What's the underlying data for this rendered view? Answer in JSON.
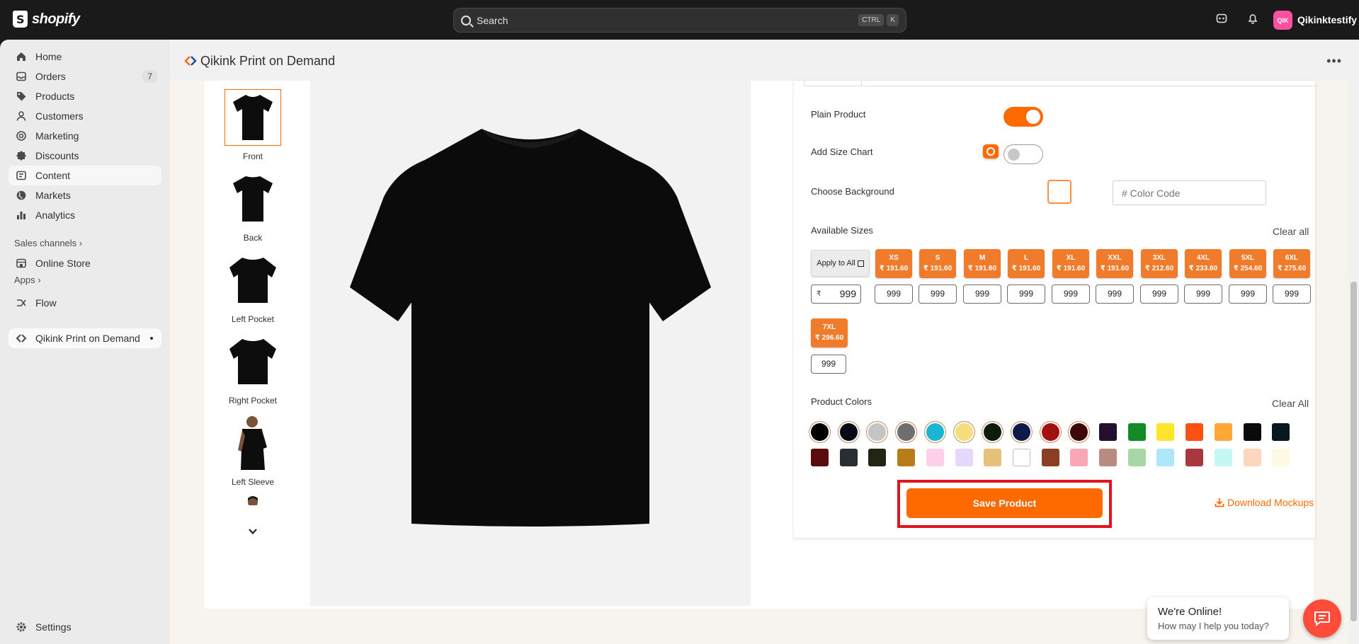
{
  "topbar": {
    "brand": "shopify",
    "search_placeholder": "Search",
    "shortcut_keys": [
      "CTRL",
      "K"
    ],
    "store_initials": "QIK",
    "store_name": "Qikinktestify"
  },
  "sidebar": {
    "items": [
      {
        "label": "Home",
        "icon": "home-icon"
      },
      {
        "label": "Orders",
        "icon": "orders-icon",
        "badge": "7"
      },
      {
        "label": "Products",
        "icon": "tag-icon"
      },
      {
        "label": "Customers",
        "icon": "person-icon"
      },
      {
        "label": "Marketing",
        "icon": "target-icon"
      },
      {
        "label": "Discounts",
        "icon": "discount-icon"
      },
      {
        "label": "Content",
        "icon": "content-icon"
      },
      {
        "label": "Markets",
        "icon": "globe-icon"
      },
      {
        "label": "Analytics",
        "icon": "chart-bar-icon"
      }
    ],
    "sales_channels_title": "Sales channels",
    "online_store": "Online Store",
    "apps_title": "Apps",
    "flow": "Flow",
    "current_app": "Qikink Print on Demand",
    "settings": "Settings"
  },
  "app": {
    "title": "Qikink Print on Demand",
    "thumbnails": [
      "Front",
      "Back",
      "Left Pocket",
      "Right Pocket",
      "Left Sleeve"
    ],
    "plain_product_label": "Plain Product",
    "plain_product_on": true,
    "add_size_chart_label": "Add Size Chart",
    "add_size_chart_on": false,
    "choose_background_label": "Choose Background",
    "color_code_placeholder": "# Color Code",
    "available_sizes_label": "Available Sizes",
    "clear_all_sizes": "Clear all",
    "apply_to_all": "Apply to All",
    "apply_price": "999",
    "currency_symbol": "₹",
    "sizes": [
      {
        "size": "XS",
        "cost": "₹ 191.60",
        "price": "999"
      },
      {
        "size": "S",
        "cost": "₹ 191.60",
        "price": "999"
      },
      {
        "size": "M",
        "cost": "₹ 191.60",
        "price": "999"
      },
      {
        "size": "L",
        "cost": "₹ 191.60",
        "price": "999"
      },
      {
        "size": "XL",
        "cost": "₹ 191.60",
        "price": "999"
      },
      {
        "size": "XXL",
        "cost": "₹ 191.60",
        "price": "999"
      },
      {
        "size": "3XL",
        "cost": "₹ 212.60",
        "price": "999"
      },
      {
        "size": "4XL",
        "cost": "₹ 233.60",
        "price": "999"
      },
      {
        "size": "5XL",
        "cost": "₹ 254.60",
        "price": "999"
      },
      {
        "size": "6XL",
        "cost": "₹ 275.60",
        "price": "999"
      },
      {
        "size": "7XL",
        "cost": "₹ 296.60",
        "price": "999"
      }
    ],
    "product_colors_label": "Product Colors",
    "clear_all_colors": "Clear All",
    "colors_row1": [
      "#000000",
      "#050a14",
      "#c4c4c4",
      "#6e6e6e",
      "#1bb5d6",
      "#f6dd7d",
      "#0d1a10",
      "#101a4a",
      "#a30f12",
      "#3c0808",
      "#23102e",
      "#148a27",
      "#fde52b",
      "#fd5113",
      "#ffa737",
      "#0a0a0a",
      "#071820"
    ],
    "colors_row2": [
      "#5a0c0c",
      "#2b2e30",
      "#232513",
      "#b87d1a",
      "#fdd2e8",
      "#e4d9fb",
      "#e7c07a",
      "#ffffff",
      "#8a3f22",
      "#f9a6b6",
      "#b88a80",
      "#a7d7a5",
      "#aee6fb",
      "#a8383e",
      "#c5f8f4",
      "#fdd7bd",
      "#fff9e4"
    ],
    "save_button": "Save Product",
    "download_mockups": "Download Mockups"
  },
  "chat": {
    "title": "We're Online!",
    "subtitle": "How may I help you today?"
  }
}
